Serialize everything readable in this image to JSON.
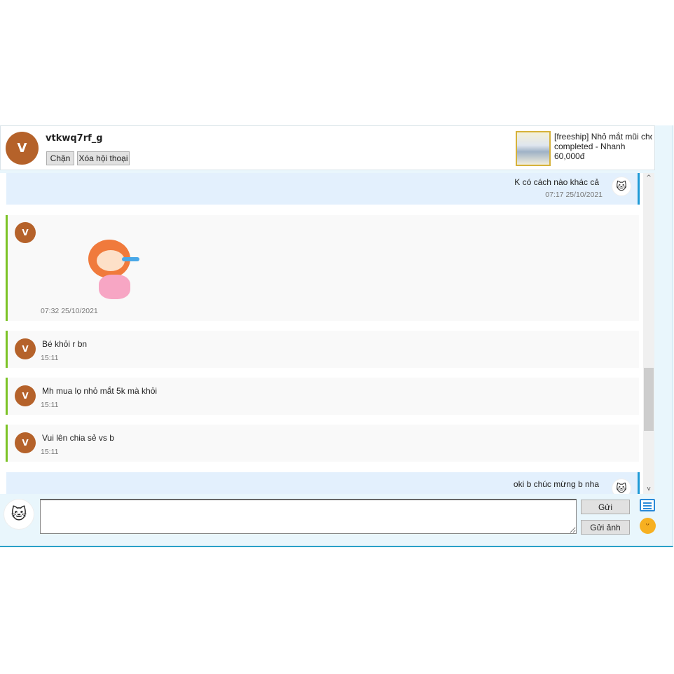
{
  "header": {
    "avatar_letter": "V",
    "username": "vtkwq7rf_g",
    "block_label": "Chặn",
    "delete_label": "Xóa hội thoại"
  },
  "product": {
    "line1": "[freeship] Nhỏ mắt mũi cho c",
    "line2": "completed - Nhanh",
    "price": "60,000đ"
  },
  "messages": [
    {
      "dir": "out",
      "text": "K có cách nào khác cả",
      "time": "07:17 25/10/2021"
    },
    {
      "dir": "in",
      "sticker": "crying-girl-sticker",
      "time": "07:32 25/10/2021"
    },
    {
      "dir": "in",
      "text": "Bé khỏi r bn",
      "time": "15:11"
    },
    {
      "dir": "in",
      "text": "Mh mua lọ nhỏ mắt 5k mà khỏi",
      "time": "15:11"
    },
    {
      "dir": "in",
      "text": "Vui lên chia sẻ vs b",
      "time": "15:11"
    },
    {
      "dir": "out",
      "text": "oki b chúc mừng b nha"
    }
  ],
  "composer": {
    "input_value": "",
    "send_label": "Gửi",
    "send_image_label": "Gửi ảnh"
  },
  "colors": {
    "avatar": "#b5622a",
    "outgoing_bg": "#e3f0fd",
    "outgoing_bar": "#1e9ad6",
    "incoming_bar": "#7cc326"
  }
}
